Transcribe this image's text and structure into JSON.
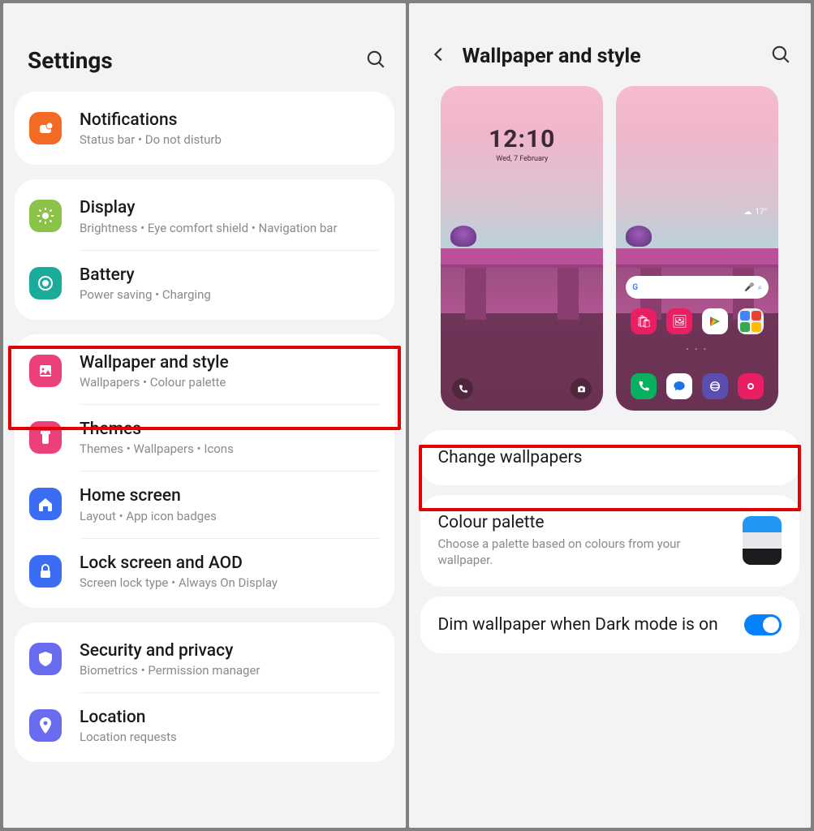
{
  "left": {
    "title": "Settings",
    "groups": [
      [
        {
          "icon": "notifications",
          "color": "#f26a24",
          "title": "Notifications",
          "sub": "Status bar  •  Do not disturb"
        }
      ],
      [
        {
          "icon": "display",
          "color": "#8bc34a",
          "title": "Display",
          "sub": "Brightness  •  Eye comfort shield  •  Navigation bar"
        },
        {
          "icon": "battery",
          "color": "#1aab9b",
          "title": "Battery",
          "sub": "Power saving  •  Charging"
        }
      ],
      [
        {
          "icon": "wallpaper",
          "color": "#ec407a",
          "title": "Wallpaper and style",
          "sub": "Wallpapers  •  Colour palette"
        },
        {
          "icon": "themes",
          "color": "#ec407a",
          "title": "Themes",
          "sub": "Themes  •  Wallpapers  •  Icons"
        },
        {
          "icon": "home",
          "color": "#3a6cf4",
          "title": "Home screen",
          "sub": "Layout  •  App icon badges"
        },
        {
          "icon": "lock",
          "color": "#3a6cf4",
          "title": "Lock screen and AOD",
          "sub": "Screen lock type  •  Always On Display"
        }
      ],
      [
        {
          "icon": "security",
          "color": "#6a6cf0",
          "title": "Security and privacy",
          "sub": "Biometrics  •  Permission manager"
        },
        {
          "icon": "location",
          "color": "#6a6cf0",
          "title": "Location",
          "sub": "Location requests"
        }
      ]
    ]
  },
  "right": {
    "title": "Wallpaper and style",
    "lock": {
      "time": "12:10",
      "date": "Wed, 7 February"
    },
    "home": {
      "temp": "17°",
      "searchG": "G"
    },
    "change": "Change wallpapers",
    "palette": {
      "title": "Colour palette",
      "sub": "Choose a palette based on colours from your wallpaper.",
      "colors": [
        "#2196f3",
        "#e8e8ec",
        "#1c1c1e"
      ]
    },
    "dim": {
      "title": "Dim wallpaper when Dark mode is on",
      "on": true
    }
  }
}
